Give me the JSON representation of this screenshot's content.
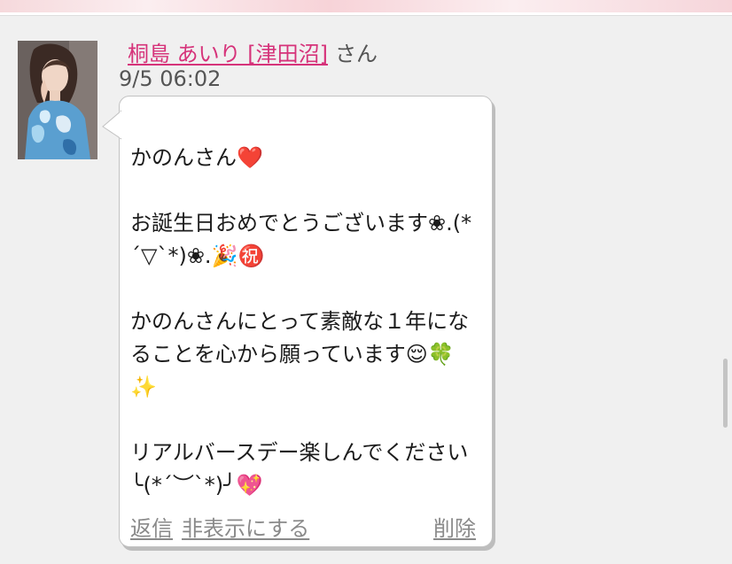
{
  "post": {
    "sender_name": "桐島 あいり [津田沼]",
    "sender_suffix": "さん",
    "timestamp": "9/5 06:02",
    "avatar_icon": "profile-photo"
  },
  "message": {
    "line1": "かのんさん❤️",
    "line2": "お誕生日おめでとうございます❀.(*",
    "line3": "´▽`*)❀.🎉㊗️",
    "line4": "かのんさんにとって素敵な１年にな",
    "line5": "ることを心から願っています😌🍀",
    "line6": "✨",
    "line7": "リアルバースデー楽しんでください",
    "line8": "╰(*´︶`*)╯💖"
  },
  "actions": {
    "reply": "返信",
    "hide": "非表示にする",
    "delete": "削除"
  },
  "colors": {
    "name_link": "#d6337a",
    "action_link": "#8a8a8a",
    "background": "#f0f0f0"
  }
}
